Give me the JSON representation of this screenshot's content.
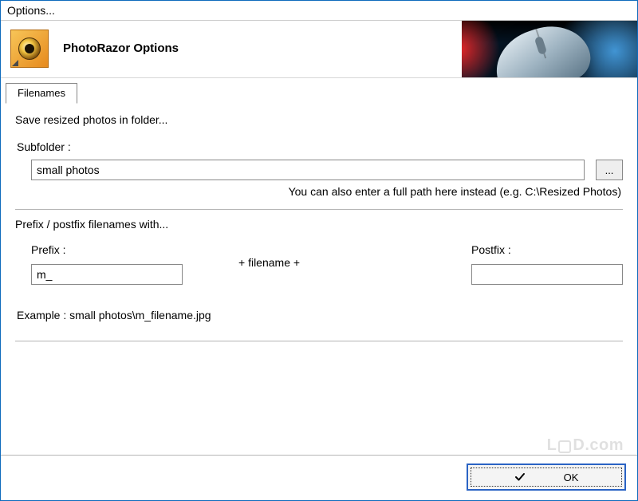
{
  "window": {
    "title": "Options..."
  },
  "header": {
    "title": "PhotoRazor Options"
  },
  "tabs": [
    {
      "label": "Filenames",
      "active": true
    }
  ],
  "filenames": {
    "save_heading": "Save resized photos in folder...",
    "subfolder_label": "Subfolder :",
    "subfolder_value": "small photos",
    "browse_label": "...",
    "subfolder_hint": "You can also enter a full path here instead (e.g. C:\\Resized Photos)",
    "affix_heading": "Prefix / postfix filenames with...",
    "prefix_label": "Prefix :",
    "prefix_value": "m_",
    "plus_filename": "+ filename +",
    "postfix_label": "Postfix :",
    "postfix_value": "",
    "example_label": "Example : small photos\\m_filename.jpg"
  },
  "buttons": {
    "ok": "OK"
  },
  "watermark": {
    "text_before": "L",
    "text_after": "D.com"
  }
}
